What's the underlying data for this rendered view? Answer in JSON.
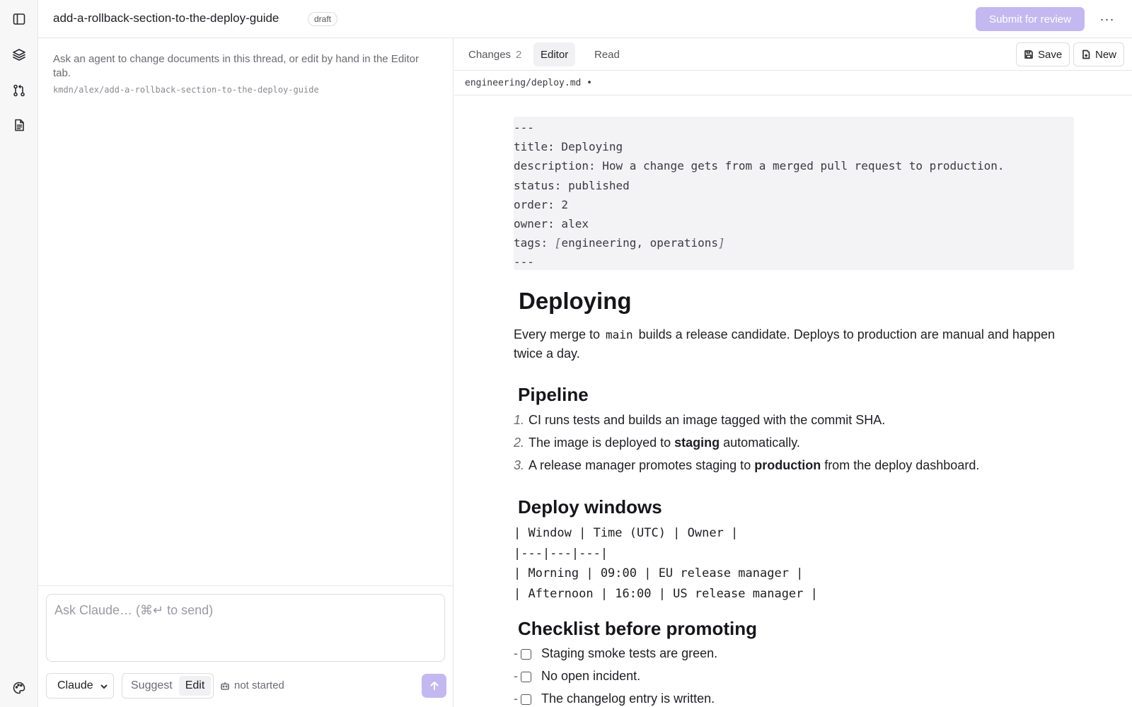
{
  "sidebar_rail": {
    "icons": [
      "panel-toggle-icon",
      "layers-icon",
      "git-pull-request-icon",
      "document-icon",
      "palette-icon"
    ]
  },
  "topbar": {
    "title": "add-a-rollback-section-to-the-deploy-guide",
    "badge": "draft",
    "submit_label": "Submit for review",
    "more_label": "···"
  },
  "chat": {
    "intro": "Ask an agent to change documents in this thread, or edit by hand in the Editor tab.",
    "branch": "kmdn/alex/add-a-rollback-section-to-the-deploy-guide",
    "composer_placeholder": "Ask Claude… (⌘↵ to send)",
    "model": "Claude",
    "modes": [
      "Suggest",
      "Edit"
    ],
    "active_mode": "Edit",
    "status": "not started"
  },
  "editor_pane": {
    "tabs": {
      "changes_label": "Changes",
      "changes_count": "2",
      "editor_label": "Editor",
      "read_label": "Read"
    },
    "save_label": "Save",
    "new_label": "New",
    "file_path": "engineering/deploy.md •"
  },
  "document": {
    "frontmatter": {
      "delim": "---",
      "title_line": "title: Deploying",
      "description_line": "description: How a change gets from a merged pull request to production.",
      "status_line": "status: published",
      "order_line": "order: 2",
      "owner_line": "owner: alex",
      "tags_key": "tags: ",
      "tags_open": "[",
      "tags_value": "engineering, operations",
      "tags_close": "]"
    },
    "h1": "Deploying",
    "intro_before": "Every merge to ",
    "intro_code": "main",
    "intro_after": " builds a release candidate. Deploys to production are manual and happen twice a day.",
    "pipeline_heading": "Pipeline",
    "pipeline": [
      {
        "num": "1.",
        "before": "CI runs tests and builds an image tagged with the commit SHA.",
        "bold": "",
        "after": ""
      },
      {
        "num": "2.",
        "before": "The image is deployed to ",
        "bold": "staging",
        "after": " automatically."
      },
      {
        "num": "3.",
        "before": "A release manager promotes staging to ",
        "bold": "production",
        "after": " from the deploy dashboard."
      }
    ],
    "windows_heading": "Deploy windows",
    "windows_table": [
      "| Window | Time (UTC) | Owner |",
      "|---|---|---|",
      "| Morning | 09:00 | EU release manager |",
      "| Afternoon | 16:00 | US release manager |"
    ],
    "checklist_heading": "Checklist before promoting",
    "checklist": [
      "Staging smoke tests are green.",
      "No open incident.",
      "The changelog entry is written."
    ]
  }
}
